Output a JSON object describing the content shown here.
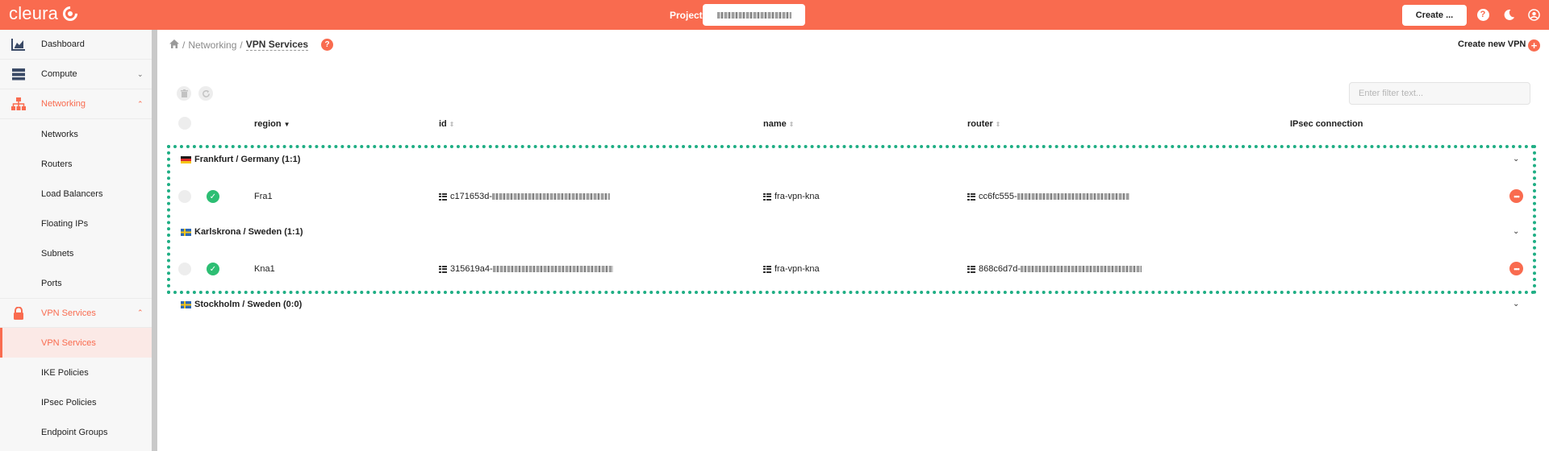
{
  "topbar": {
    "logo_text": "cleura",
    "project_label": "Project",
    "create_label": "Create ...",
    "icons": [
      "help-icon",
      "moon-icon",
      "user-icon"
    ],
    "accent": "#f96b4f"
  },
  "sidebar": {
    "items": [
      {
        "label": "Dashboard",
        "icon": "chart-icon",
        "type": "section"
      },
      {
        "label": "Compute",
        "icon": "server-icon",
        "type": "section",
        "chevron": "down"
      },
      {
        "label": "Networking",
        "icon": "network-icon",
        "type": "section",
        "chevron": "up",
        "active": true
      },
      {
        "label": "Networks",
        "type": "sub"
      },
      {
        "label": "Routers",
        "type": "sub"
      },
      {
        "label": "Load Balancers",
        "type": "sub"
      },
      {
        "label": "Floating IPs",
        "type": "sub"
      },
      {
        "label": "Subnets",
        "type": "sub"
      },
      {
        "label": "Ports",
        "type": "sub"
      },
      {
        "label": "VPN Services",
        "icon": "lock-icon",
        "type": "section",
        "chevron": "up",
        "active": true
      },
      {
        "label": "VPN Services",
        "type": "sub",
        "current": true
      },
      {
        "label": "IKE Policies",
        "type": "sub"
      },
      {
        "label": "IPsec Policies",
        "type": "sub"
      },
      {
        "label": "Endpoint Groups",
        "type": "sub"
      }
    ]
  },
  "breadcrumb": {
    "home_icon": "home-icon",
    "sep": "/",
    "networking": "Networking",
    "current": "VPN Services"
  },
  "actions": {
    "create_new_vpn": "Create new VPN"
  },
  "filter": {
    "placeholder": "Enter filter text..."
  },
  "table": {
    "headers": {
      "region": "region",
      "id": "id",
      "name": "name",
      "router": "router",
      "ipsec": "IPsec connection"
    },
    "groups": [
      {
        "label": "Frankfurt / Germany (1:1)",
        "flag": "de",
        "rows": [
          {
            "region": "Fra1",
            "id": "c171653d-",
            "name": "fra-vpn-kna",
            "router": "cc6fc555-",
            "status": "ok"
          }
        ]
      },
      {
        "label": "Karlskrona / Sweden (1:1)",
        "flag": "se",
        "rows": [
          {
            "region": "Kna1",
            "id": "315619a4-",
            "name": "fra-vpn-kna",
            "router": "868c6d7d-",
            "status": "ok"
          }
        ]
      },
      {
        "label": "Stockholm / Sweden (0:0)",
        "flag": "se",
        "rows": []
      }
    ]
  },
  "colors": {
    "highlight": "#1fae84",
    "status_ok": "#2dbe73"
  }
}
